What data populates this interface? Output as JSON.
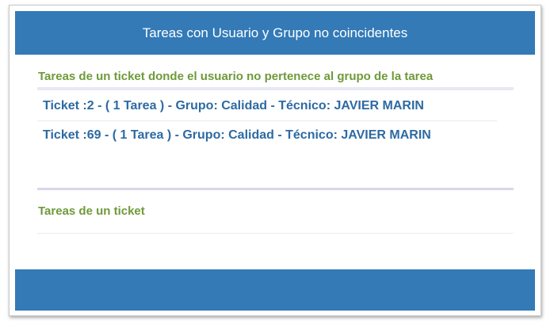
{
  "panel": {
    "header_title": "Tareas con Usuario y Grupo no coincidentes"
  },
  "sections": {
    "mismatch": {
      "title": "Tareas de un ticket donde el usuario no pertenece al grupo de la tarea",
      "tickets": [
        {
          "label": "Ticket :2 - ( 1 Tarea ) - Grupo: Calidad - Técnico: JAVIER MARIN"
        },
        {
          "label": "Ticket :69 - ( 1 Tarea ) - Grupo: Calidad - Técnico: JAVIER MARIN"
        }
      ]
    },
    "ticket_tasks": {
      "title": "Tareas de un ticket"
    }
  },
  "colors": {
    "header_bg": "#337ab7",
    "section_title": "#6e9a3a",
    "link": "#2d6aa3"
  }
}
